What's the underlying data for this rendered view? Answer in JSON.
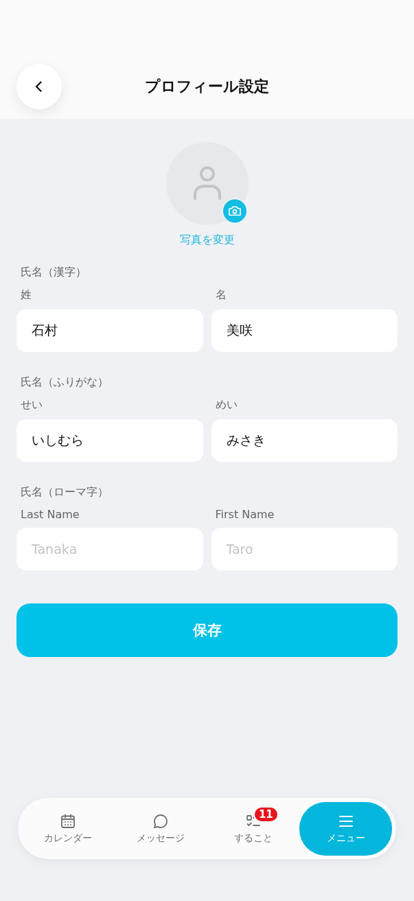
{
  "header": {
    "title": "プロフィール設定"
  },
  "avatar": {
    "change_label": "写真を変更"
  },
  "sections": [
    {
      "label": "氏名（漢字）",
      "fields": [
        {
          "label": "姓",
          "value": "石村"
        },
        {
          "label": "名",
          "value": "美咲"
        }
      ]
    },
    {
      "label": "氏名（ふりがな）",
      "fields": [
        {
          "label": "せい",
          "value": "いしむら"
        },
        {
          "label": "めい",
          "value": "みさき"
        }
      ]
    },
    {
      "label": "氏名（ローマ字）",
      "fields": [
        {
          "label": "Last Name",
          "placeholder": "Tanaka"
        },
        {
          "label": "First Name",
          "placeholder": "Taro"
        }
      ]
    }
  ],
  "save_button": "保存",
  "nav": [
    {
      "kind": "calendar",
      "label": "カレンダー",
      "selected": false
    },
    {
      "kind": "message",
      "label": "メッセージ",
      "selected": false
    },
    {
      "kind": "todo",
      "label": "すること",
      "selected": false,
      "badge": "11"
    },
    {
      "kind": "menu",
      "label": "メニュー",
      "selected": true
    }
  ]
}
